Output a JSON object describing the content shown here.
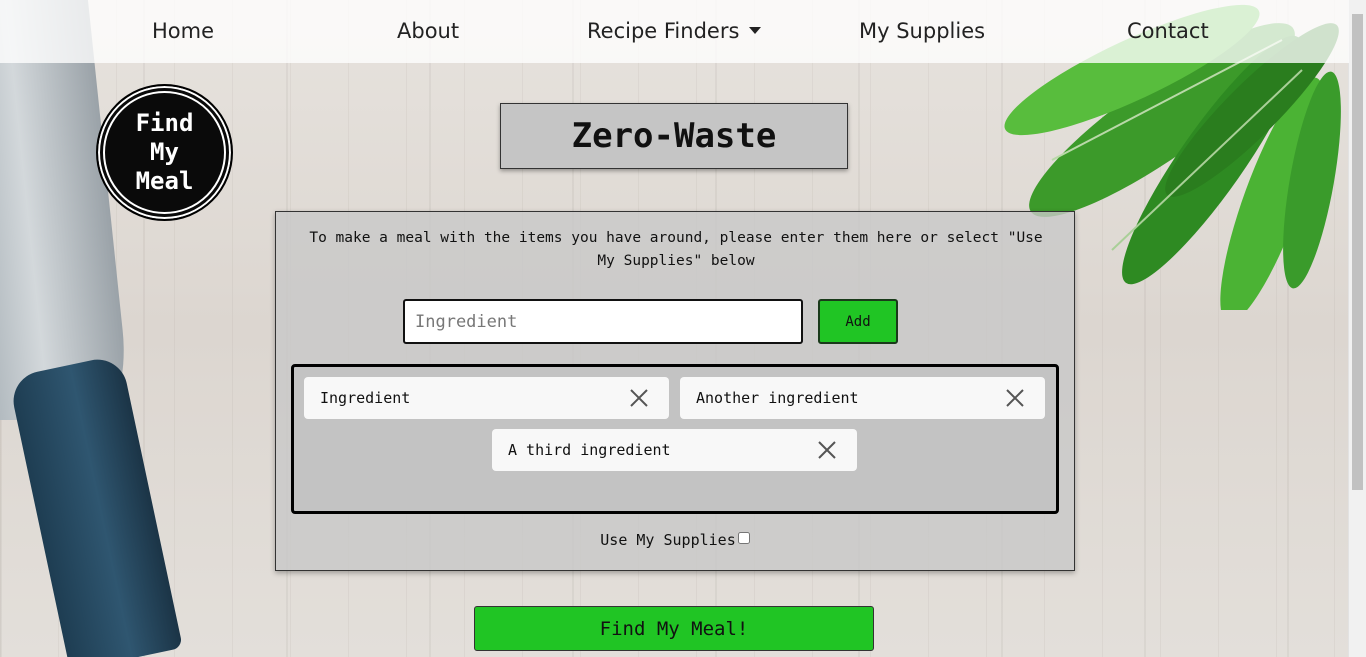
{
  "nav": {
    "home": "Home",
    "about": "About",
    "recipe_finders": "Recipe Finders",
    "my_supplies": "My Supplies",
    "contact": "Contact"
  },
  "logo": {
    "line1": "Find",
    "line2": "My",
    "line3": "Meal"
  },
  "page_title": "Zero-Waste",
  "instructions": "To make a meal with the items you have around, please enter them here or select \"Use My Supplies\" below",
  "ingredient_input": {
    "placeholder": "Ingredient",
    "value": ""
  },
  "add_button_label": "Add",
  "ingredients": [
    "Ingredient",
    "Another ingredient",
    "A third ingredient"
  ],
  "use_my_supplies": {
    "label": "Use My Supplies",
    "checked": false
  },
  "find_button_label": "Find My Meal!",
  "colors": {
    "accent_green": "#20c524",
    "panel_gray": "#c5c5c5",
    "logo_black": "#0a0a0a"
  },
  "icons": {
    "dropdown": "caret-down-icon",
    "remove": "close-icon"
  }
}
